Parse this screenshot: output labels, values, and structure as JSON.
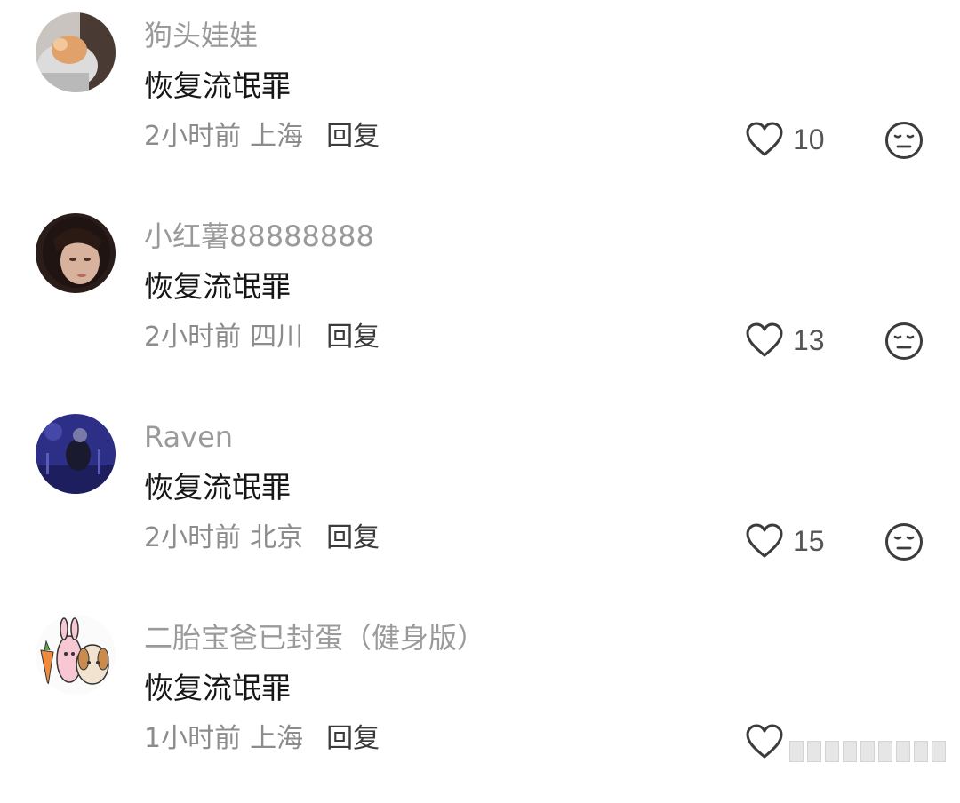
{
  "comments": [
    {
      "username": "狗头娃娃",
      "content": "恢复流氓罪",
      "time": "2小时前",
      "location": "上海",
      "reply_label": "回复",
      "likes": "10"
    },
    {
      "username": "小红薯88888888",
      "content": "恢复流氓罪",
      "time": "2小时前",
      "location": "四川",
      "reply_label": "回复",
      "likes": "13"
    },
    {
      "username": "Raven",
      "content": "恢复流氓罪",
      "time": "2小时前",
      "location": "北京",
      "reply_label": "回复",
      "likes": "15"
    },
    {
      "username": "二胎宝爸已封蛋（健身版）",
      "content": "恢复流氓罪",
      "time": "1小时前",
      "location": "上海",
      "reply_label": "回复",
      "likes": ""
    }
  ],
  "icons": {
    "like": "heart-outline-icon",
    "dislike": "neutral-face-icon"
  },
  "colors": {
    "username": "#9a9a9a",
    "content": "#161616",
    "meta": "#8c8c8c",
    "icon": "#3c3c3c"
  }
}
